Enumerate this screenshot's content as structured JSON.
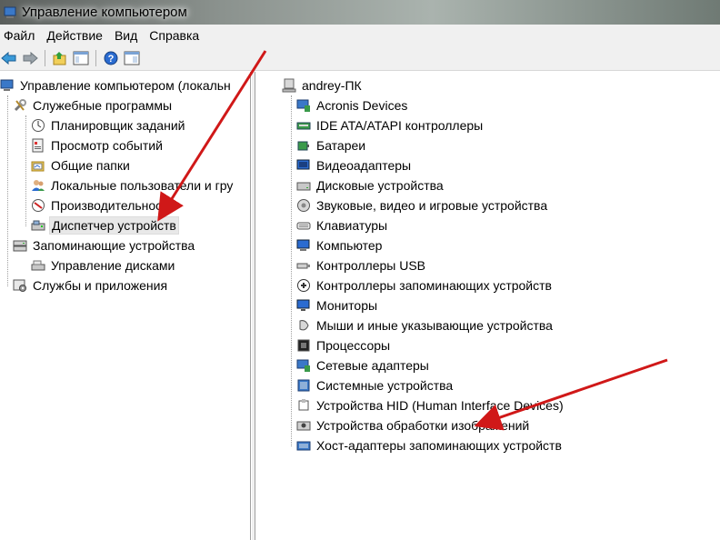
{
  "window": {
    "title": "Управление компьютером"
  },
  "menu": [
    "Файл",
    "Действие",
    "Вид",
    "Справка"
  ],
  "left_tree": {
    "root": "Управление компьютером (локальн",
    "system_tools": "Служебные программы",
    "task_scheduler": "Планировщик заданий",
    "event_viewer": "Просмотр событий",
    "shared_folders": "Общие папки",
    "local_users": "Локальные пользователи и гру",
    "performance": "Производительность",
    "device_manager": "Диспетчер устройств",
    "storage": "Запоминающие устройства",
    "disk_management": "Управление дисками",
    "services_apps": "Службы и приложения"
  },
  "right_tree": {
    "computer": "andrey-ПК",
    "devices": [
      "Acronis Devices",
      "IDE ATA/ATAPI контроллеры",
      "Батареи",
      "Видеоадаптеры",
      "Дисковые устройства",
      "Звуковые, видео и игровые устройства",
      "Клавиатуры",
      "Компьютер",
      "Контроллеры USB",
      "Контроллеры запоминающих устройств",
      "Мониторы",
      "Мыши и иные указывающие устройства",
      "Процессоры",
      "Сетевые адаптеры",
      "Системные устройства",
      "Устройства HID (Human Interface Devices)",
      "Устройства обработки изображений",
      "Хост-адаптеры запоминающих устройств"
    ]
  },
  "colors": {
    "arrow": "#d01818",
    "accent": "#2a6bd0"
  }
}
